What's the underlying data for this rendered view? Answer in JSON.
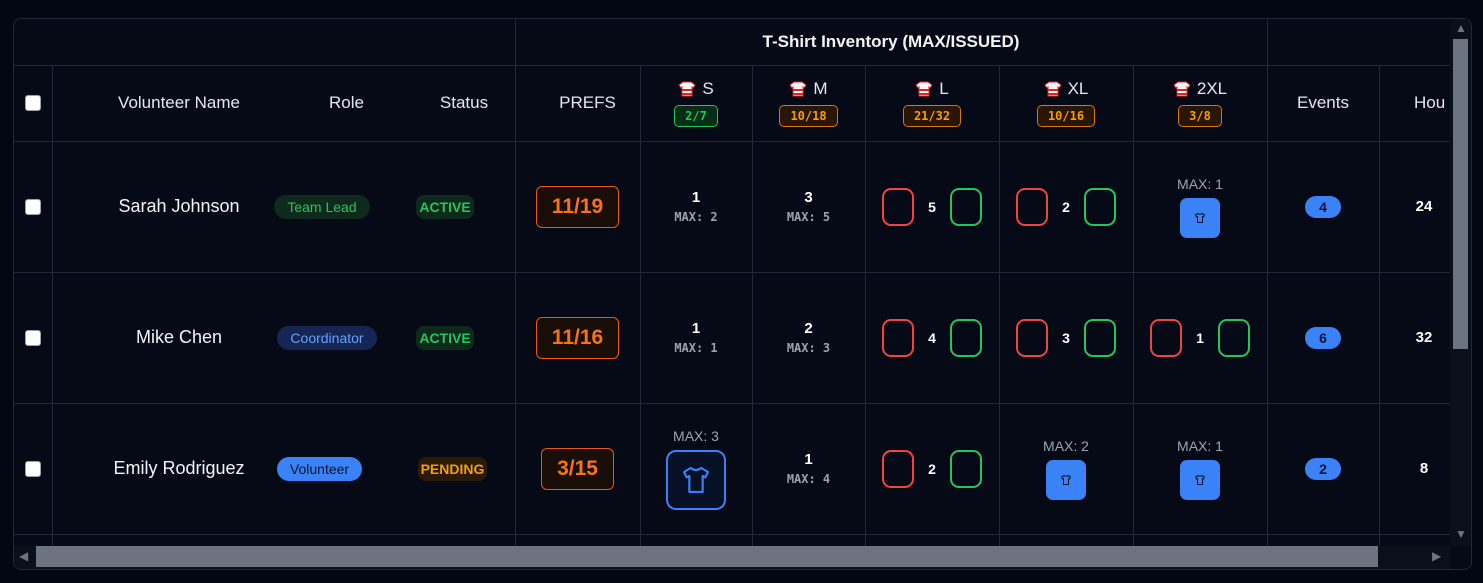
{
  "header": {
    "group_title": "T-Shirt Inventory (MAX/ISSUED)",
    "volunteer_name": "Volunteer Name",
    "role": "Role",
    "status": "Status",
    "prefs": "PREFS",
    "events": "Events",
    "hours": "Hou",
    "sizes": [
      {
        "label": "S",
        "badge": "2/7",
        "tone": "green"
      },
      {
        "label": "M",
        "badge": "10/18",
        "tone": "orange"
      },
      {
        "label": "L",
        "badge": "21/32",
        "tone": "orange"
      },
      {
        "label": "XL",
        "badge": "10/16",
        "tone": "orange"
      },
      {
        "label": "2XL",
        "badge": "3/8",
        "tone": "orange"
      }
    ]
  },
  "rows": [
    {
      "name": "Sarah Johnson",
      "role": "Team Lead",
      "status": "ACTIVE",
      "prefs": "11/19",
      "s": {
        "count": "1",
        "max": "MAX: 2"
      },
      "m": {
        "count": "3",
        "max": "MAX: 5"
      },
      "l": {
        "issued": "5"
      },
      "xl": {
        "issued": "2"
      },
      "xxl": {
        "max": "MAX: 1"
      },
      "events": "4",
      "hours": "24"
    },
    {
      "name": "Mike Chen",
      "role": "Coordinator",
      "status": "ACTIVE",
      "prefs": "11/16",
      "s": {
        "count": "1",
        "max": "MAX: 1"
      },
      "m": {
        "count": "2",
        "max": "MAX: 3"
      },
      "l": {
        "issued": "4"
      },
      "xl": {
        "issued": "3"
      },
      "xxl": {
        "issued": "1"
      },
      "events": "6",
      "hours": "32"
    },
    {
      "name": "Emily Rodriguez",
      "role": "Volunteer",
      "status": "PENDING",
      "prefs": "3/15",
      "s": {
        "max": "MAX: 3"
      },
      "m": {
        "count": "1",
        "max": "MAX: 4"
      },
      "l": {
        "issued": "2"
      },
      "xl": {
        "max": "MAX: 2"
      },
      "xxl": {
        "max": "MAX: 1"
      },
      "events": "2",
      "hours": "8"
    }
  ],
  "colors": {
    "accent_blue": "#3b82f6",
    "green": "#22c55e",
    "red": "#ef4444",
    "orange": "#f97316"
  },
  "icons": {
    "shirt_header": "red-white-striped-shirt-icon",
    "shirt_button": "tshirt-outline-icon"
  }
}
